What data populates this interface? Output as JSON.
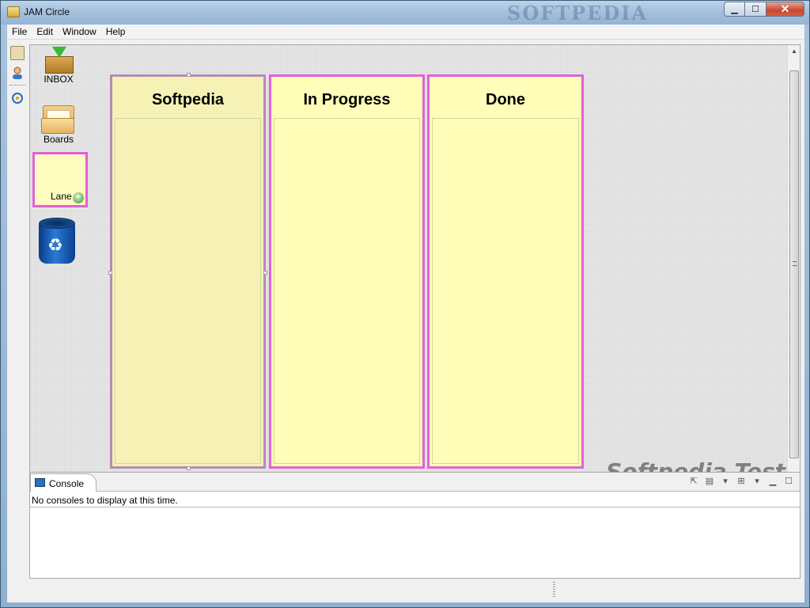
{
  "window": {
    "title": "JAM Circle",
    "title_watermark": "SOFTPEDIA",
    "controls": {
      "minimize": "▁",
      "maximize": "☐",
      "close": "✕"
    }
  },
  "menu": [
    "File",
    "Edit",
    "Window",
    "Help"
  ],
  "side_toolbar": {
    "icons": [
      "board-icon",
      "user-icon",
      "activity-icon"
    ]
  },
  "palette": {
    "inbox_label": "INBOX",
    "boards_label": "Boards",
    "lane_label": "Lane",
    "lane_add": "+",
    "recycle_symbol": "♻"
  },
  "lanes": [
    {
      "title": "Softpedia",
      "selected": true
    },
    {
      "title": "In Progress",
      "selected": false
    },
    {
      "title": "Done",
      "selected": false
    }
  ],
  "canvas_watermark": "Softpedia Test",
  "console": {
    "tab_label": "Console",
    "message": "No consoles to display at this time."
  },
  "colors": {
    "lane_fill": "#fffdb8",
    "lane_border": "#e361d8",
    "selected_lane_fill": "#f6f2b6"
  }
}
